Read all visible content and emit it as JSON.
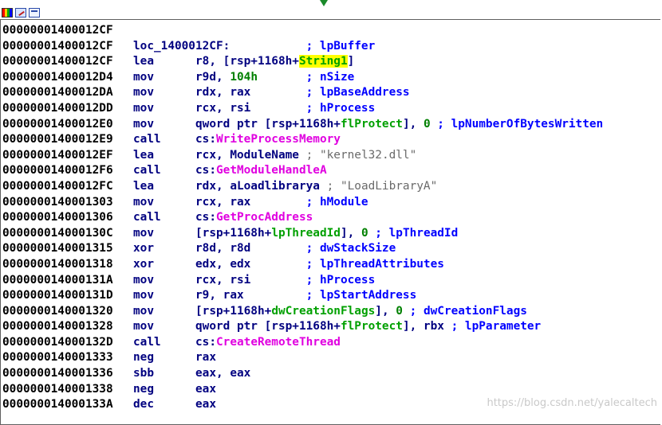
{
  "window": {
    "toolbar_icons": [
      "graph-overview-icon",
      "edit-icon",
      "view-icon"
    ],
    "watermark": "https://blog.csdn.net/yalecaltech"
  },
  "colors": {
    "address": "#000000",
    "mnemonic": "#000080",
    "comment": "#0000ff",
    "string_comment": "#6a6a6a",
    "api_name": "#e000e0",
    "stack_var": "#00a000",
    "highlight": "#ffff00"
  },
  "lines": [
    {
      "addr": "00000001400012CF",
      "label": ""
    },
    {
      "addr": "00000001400012CF",
      "label": "loc_1400012CF:",
      "pad": "           ",
      "comment": "; lpBuffer"
    },
    {
      "addr": "00000001400012CF",
      "mn": "lea",
      "op_a": "r8, [rsp+1168h+",
      "op_hl": "String1",
      "op_b": "]"
    },
    {
      "addr": "00000001400012D4",
      "mn": "mov",
      "op_a": "r9d, ",
      "num": "104h",
      "pad": "       ",
      "comment": "; nSize"
    },
    {
      "addr": "00000001400012DA",
      "mn": "mov",
      "op_a": "rdx, rax",
      "pad": "        ",
      "comment": "; lpBaseAddress"
    },
    {
      "addr": "00000001400012DD",
      "mn": "mov",
      "op_a": "rcx, rsi",
      "pad": "        ",
      "comment": "; hProcess"
    },
    {
      "addr": "00000001400012E0",
      "mn": "mov",
      "op_a": "qword ptr [rsp+1168h+",
      "var": "flProtect",
      "op_b": "], ",
      "num": "0",
      "pad": " ",
      "comment": "; lpNumberOfBytesWritten"
    },
    {
      "addr": "00000001400012E9",
      "mn": "call",
      "seg": "cs:",
      "fn": "WriteProcessMemory"
    },
    {
      "addr": "00000001400012EF",
      "mn": "lea",
      "op_a": "rcx, ModuleName",
      "pad": " ",
      "scomment": "; \"kernel32.dll\""
    },
    {
      "addr": "00000001400012F6",
      "mn": "call",
      "seg": "cs:",
      "fn": "GetModuleHandleA"
    },
    {
      "addr": "00000001400012FC",
      "mn": "lea",
      "op_a": "rdx, aLoadlibrarya",
      "pad": " ",
      "scomment": "; \"LoadLibraryA\""
    },
    {
      "addr": "0000000140001303",
      "mn": "mov",
      "op_a": "rcx, rax",
      "pad": "        ",
      "comment": "; hModule"
    },
    {
      "addr": "0000000140001306",
      "mn": "call",
      "seg": "cs:",
      "fn": "GetProcAddress"
    },
    {
      "addr": "000000014000130C",
      "mn": "mov",
      "op_a": "[rsp+1168h+",
      "var": "lpThreadId",
      "op_b": "], ",
      "num": "0",
      "pad": " ",
      "comment": "; lpThreadId"
    },
    {
      "addr": "0000000140001315",
      "mn": "xor",
      "op_a": "r8d, r8d",
      "pad": "        ",
      "comment": "; dwStackSize"
    },
    {
      "addr": "0000000140001318",
      "mn": "xor",
      "op_a": "edx, edx",
      "pad": "        ",
      "comment": "; lpThreadAttributes"
    },
    {
      "addr": "000000014000131A",
      "mn": "mov",
      "op_a": "rcx, rsi",
      "pad": "        ",
      "comment": "; hProcess"
    },
    {
      "addr": "000000014000131D",
      "mn": "mov",
      "op_a": "r9, rax",
      "pad": "         ",
      "comment": "; lpStartAddress"
    },
    {
      "addr": "0000000140001320",
      "mn": "mov",
      "op_a": "[rsp+1168h+",
      "var": "dwCreationFlags",
      "op_b": "], ",
      "num": "0",
      "pad": " ",
      "comment": "; dwCreationFlags"
    },
    {
      "addr": "0000000140001328",
      "mn": "mov",
      "op_a": "qword ptr [rsp+1168h+",
      "var": "flProtect",
      "op_b": "], rbx",
      "pad": " ",
      "comment": "; lpParameter"
    },
    {
      "addr": "000000014000132D",
      "mn": "call",
      "seg": "cs:",
      "fn": "CreateRemoteThread"
    },
    {
      "addr": "0000000140001333",
      "mn": "neg",
      "op_a": "rax"
    },
    {
      "addr": "0000000140001336",
      "mn": "sbb",
      "op_a": "eax, eax"
    },
    {
      "addr": "0000000140001338",
      "mn": "neg",
      "op_a": "eax"
    },
    {
      "addr": "000000014000133A",
      "mn": "dec",
      "op_a": "eax"
    }
  ]
}
